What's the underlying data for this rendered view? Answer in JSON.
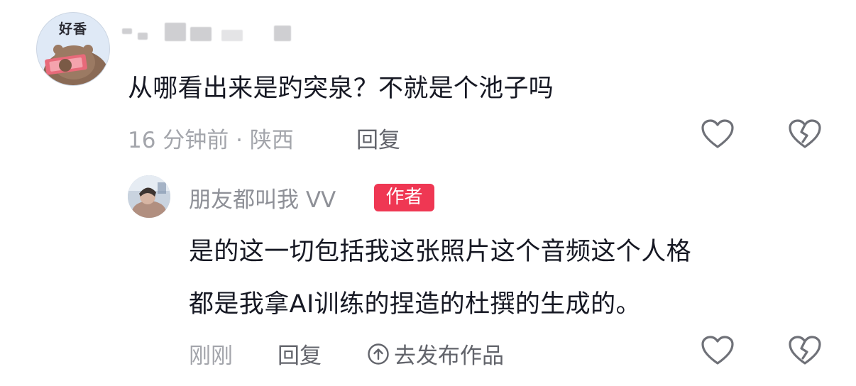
{
  "comment": {
    "avatar_tag": "好香",
    "text": "从哪看出来是趵突泉？不就是个池子吗",
    "time_location": "16 分钟前 · 陕西",
    "reply_label": "回复"
  },
  "reply": {
    "author_name": "朋友都叫我 VV",
    "author_badge": "作者",
    "text_line1": "是的这一切包括我这张照片这个音频这个人格",
    "text_line2": "都是我拿AI训练的捏造的杜撰的生成的。",
    "time": "刚刚",
    "reply_label": "回复",
    "publish_label": "去发布作品"
  },
  "icons": [
    "heart-outline-icon",
    "broken-heart-icon",
    "arrow-up-circle-icon"
  ],
  "colors": {
    "badge_red": "#ef3753",
    "meta_gray": "#a3a5ab",
    "text_dark": "#161823"
  }
}
